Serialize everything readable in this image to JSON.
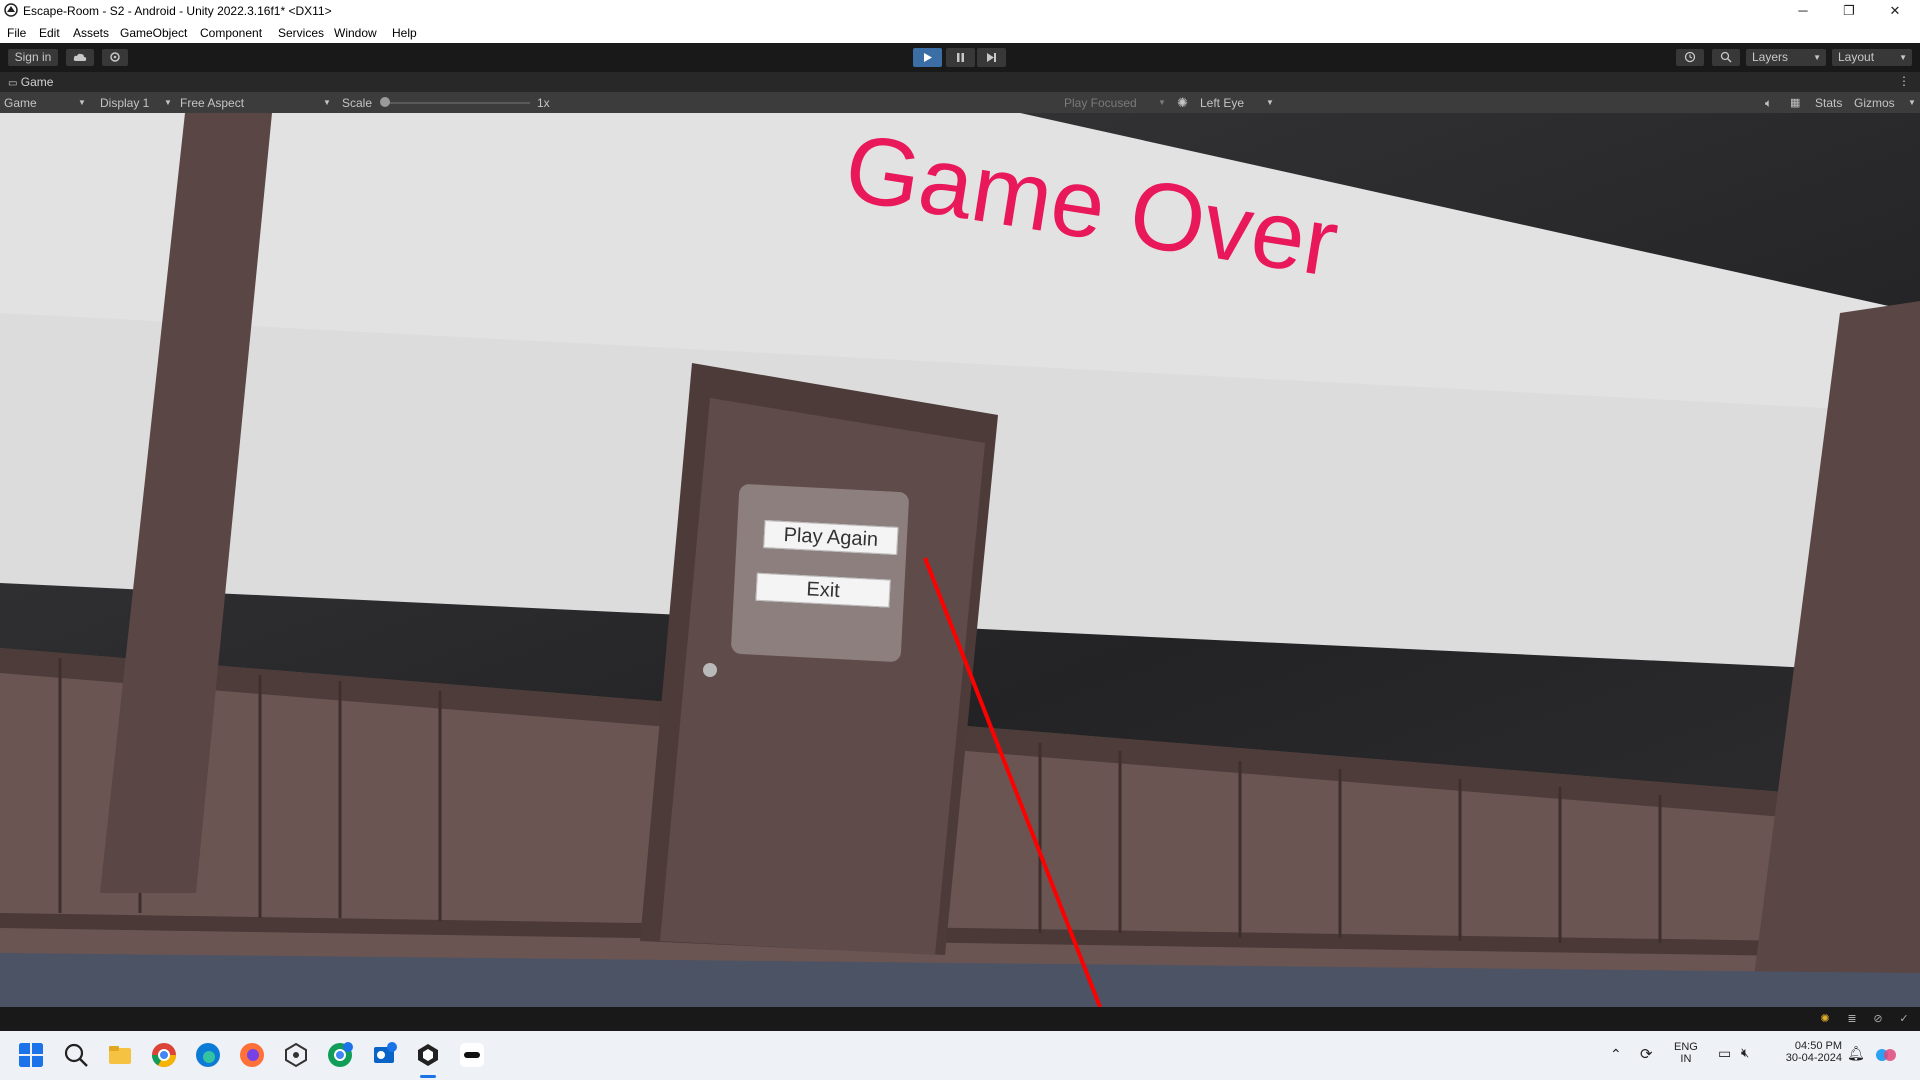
{
  "window": {
    "title": "Escape-Room - S2 - Android - Unity 2022.3.16f1* <DX11>",
    "minimize": "─",
    "maximize": "❐",
    "close": "✕"
  },
  "menu": [
    "File",
    "Edit",
    "Assets",
    "GameObject",
    "Component",
    "Services",
    "Window",
    "Help"
  ],
  "toolbar": {
    "sign_in": "Sign in",
    "layers": "Layers",
    "layout": "Layout"
  },
  "tab": {
    "label": "Game"
  },
  "game_toolbar": {
    "mode": "Game",
    "display": "Display 1",
    "aspect": "Free Aspect",
    "scale_label": "Scale",
    "scale_value": "1x",
    "play_focused": "Play Focused",
    "eye": "Left Eye",
    "stats": "Stats",
    "gizmos": "Gizmos"
  },
  "scene": {
    "headline": "Game Over",
    "play_again": "Play Again",
    "exit": "Exit",
    "colors": {
      "headline": "#e8185a",
      "laser": "#ff0000",
      "wall": "#dedede",
      "wood": "#5e4a48"
    }
  },
  "system_tray": {
    "lang_top": "ENG",
    "lang_bottom": "IN",
    "time": "04:50 PM",
    "date": "30-04-2024"
  }
}
